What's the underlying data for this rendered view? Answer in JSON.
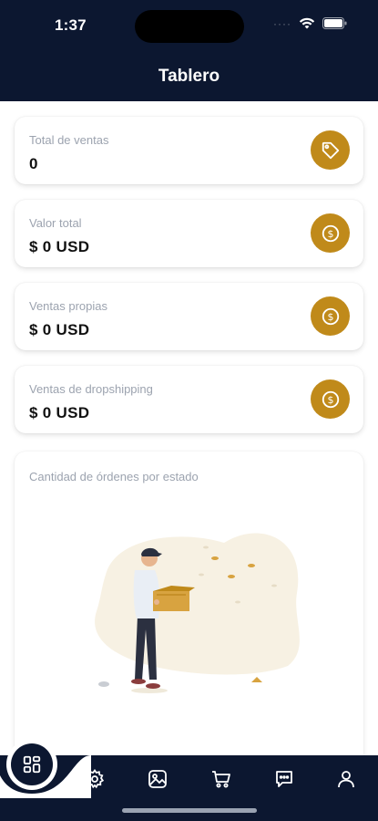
{
  "status_bar": {
    "time": "1:37",
    "signal": "····"
  },
  "header": {
    "title": "Tablero"
  },
  "cards": [
    {
      "label": "Total de ventas",
      "value": "0",
      "icon": "tag-icon"
    },
    {
      "label": "Valor total",
      "value": "$ 0 USD",
      "icon": "dollar-coin-icon"
    },
    {
      "label": "Ventas propias",
      "value": "$ 0 USD",
      "icon": "dollar-coin-icon"
    },
    {
      "label": "Ventas de dropshipping",
      "value": "$ 0 USD",
      "icon": "dollar-coin-icon"
    }
  ],
  "orders_chart": {
    "label": "Cantidad de órdenes por estado"
  },
  "nav": {
    "items": [
      "dashboard-icon",
      "gear-icon",
      "image-icon",
      "cart-icon",
      "chat-icon",
      "user-icon"
    ]
  },
  "colors": {
    "header_bg": "#0c1730",
    "accent": "#c08a1a"
  }
}
